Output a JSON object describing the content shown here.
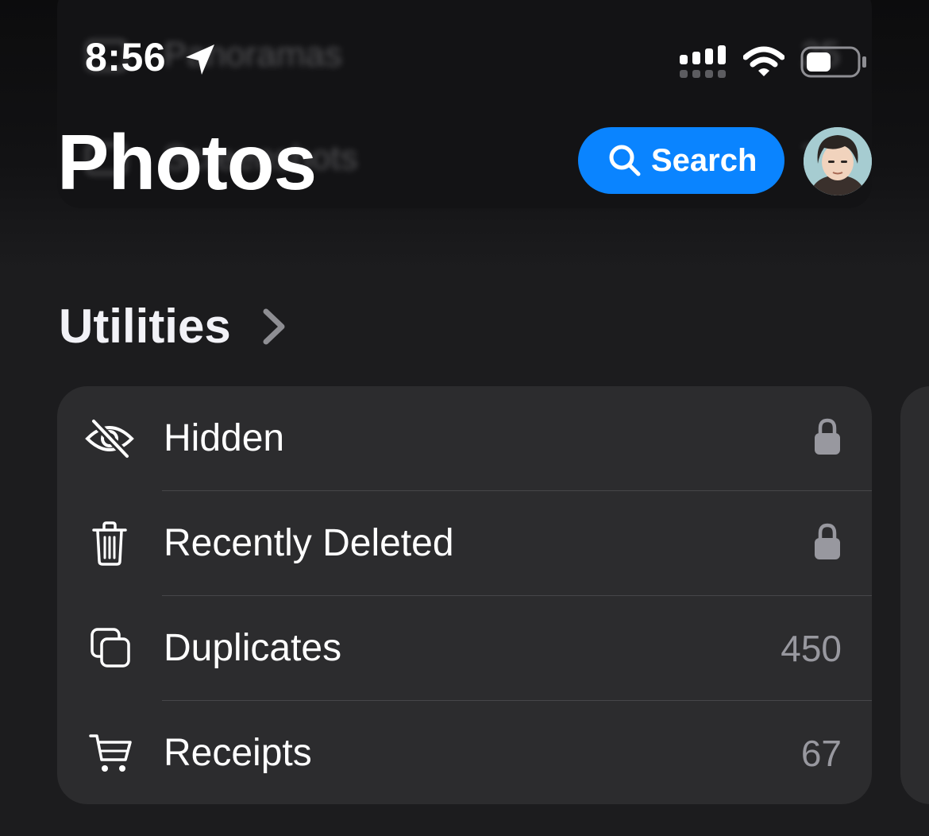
{
  "status_bar": {
    "time": "8:56",
    "icons": [
      "location-arrow-icon",
      "cellular-signal-icon",
      "wifi-icon",
      "battery-icon"
    ]
  },
  "header": {
    "title": "Photos",
    "search_label": "Search",
    "search_icon": "magnifying-glass-icon"
  },
  "background_list": [
    {
      "label": "Panoramas",
      "count": "25"
    },
    {
      "label": "Screenshots",
      "count": "76"
    }
  ],
  "utilities": {
    "title": "Utilities",
    "items": [
      {
        "label": "Hidden",
        "icon": "eye-slash-icon",
        "trailing": "lock-icon"
      },
      {
        "label": "Recently Deleted",
        "icon": "trash-icon",
        "trailing": "lock-icon"
      },
      {
        "label": "Duplicates",
        "icon": "duplicate-squares-icon",
        "count": "450"
      },
      {
        "label": "Receipts",
        "icon": "cart-icon",
        "count": "67"
      }
    ]
  },
  "colors": {
    "background": "#1c1c1e",
    "card": "#2c2c2e",
    "accent": "#0a84ff",
    "secondary_text": "#98989f"
  }
}
